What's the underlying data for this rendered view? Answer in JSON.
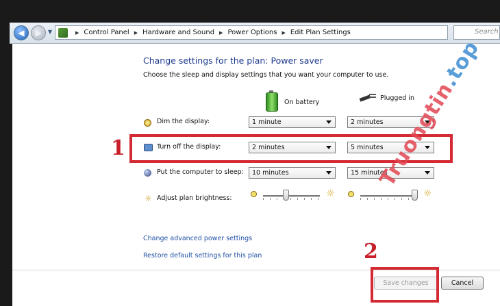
{
  "breadcrumb": [
    "Control Panel",
    "Hardware and Sound",
    "Power Options",
    "Edit Plan Settings"
  ],
  "search_placeholder": "Search",
  "plan": {
    "title": "Change settings for the plan: Power saver",
    "subtitle": "Choose the sleep and display settings that you want your computer to use."
  },
  "columns": {
    "battery": "On battery",
    "plugged": "Plugged in"
  },
  "rows": [
    {
      "label": "Dim the display:",
      "battery": "1 minute",
      "plugged": "2 minutes"
    },
    {
      "label": "Turn off the display:",
      "battery": "2 minutes",
      "plugged": "5 minutes"
    },
    {
      "label": "Put the computer to sleep:",
      "battery": "10 minutes",
      "plugged": "15 minutes"
    }
  ],
  "brightness": {
    "label": "Adjust plan brightness:",
    "battery_level": 0.4,
    "plugged_level": 0.95
  },
  "links": {
    "advanced": "Change advanced power settings",
    "restore": "Restore default settings for this plan"
  },
  "buttons": {
    "save": "Save changes",
    "cancel": "Cancel"
  },
  "annotations": {
    "step1": "1",
    "step2": "2"
  },
  "watermark": {
    "text": "Truongtin",
    "suffix": ".top"
  },
  "colors": {
    "highlight": "#d42a33",
    "link": "#1e4fa3",
    "title": "#1e3a8f"
  }
}
